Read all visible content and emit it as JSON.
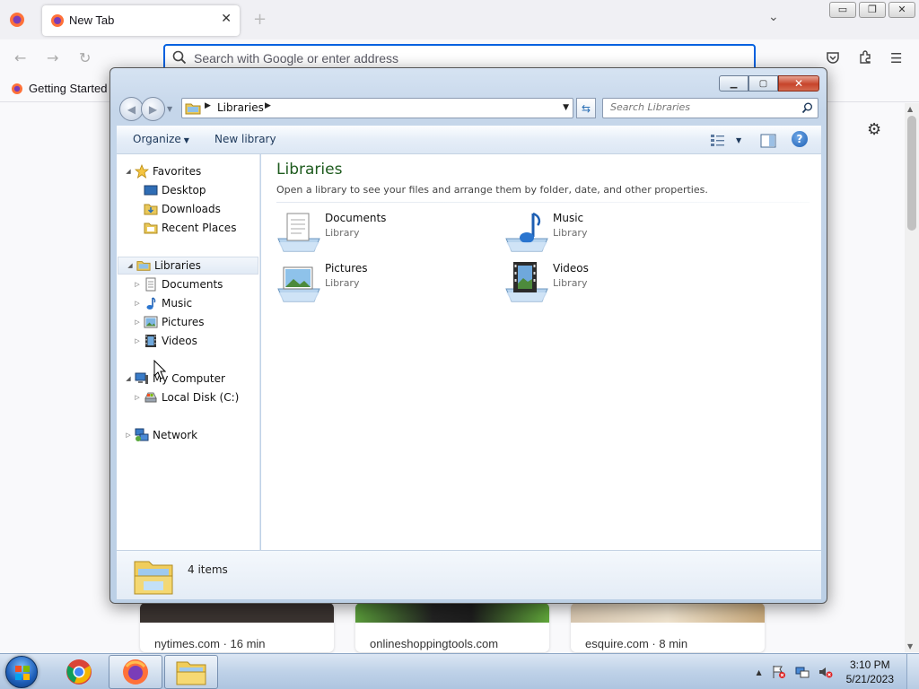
{
  "browser": {
    "tab_title": "New Tab",
    "url_placeholder": "Search with Google or enter address",
    "bookmark": "Getting Started",
    "tiles": [
      {
        "label": "nytimes.com · 16 min"
      },
      {
        "label": "onlineshoppingtools.com"
      },
      {
        "label": "esquire.com · 8 min"
      }
    ]
  },
  "explorer": {
    "address": {
      "crumb": "Libraries"
    },
    "search": {
      "placeholder": "Search Libraries"
    },
    "toolbar": {
      "organize": "Organize",
      "new_library": "New library"
    },
    "nav": {
      "favorites": "Favorites",
      "desktop": "Desktop",
      "downloads": "Downloads",
      "recent": "Recent Places",
      "libraries": "Libraries",
      "documents": "Documents",
      "music": "Music",
      "pictures": "Pictures",
      "videos": "Videos",
      "computer": "My Computer",
      "local_disk": "Local Disk (C:)",
      "network": "Network"
    },
    "content": {
      "title": "Libraries",
      "subtitle": "Open a library to see your files and arrange them by folder, date, and other properties.",
      "items": [
        {
          "name": "Documents",
          "type": "Library",
          "icon": "documents-library-icon"
        },
        {
          "name": "Music",
          "type": "Library",
          "icon": "music-library-icon"
        },
        {
          "name": "Pictures",
          "type": "Library",
          "icon": "pictures-library-icon"
        },
        {
          "name": "Videos",
          "type": "Library",
          "icon": "videos-library-icon"
        }
      ]
    },
    "details": {
      "count": "4 items"
    }
  },
  "taskbar": {
    "time": "3:10 PM",
    "date": "5/21/2023"
  },
  "colors": {
    "accent_blue": "#0061e0",
    "content_title_green": "#1e5b1e",
    "close_red": "#c7442b"
  }
}
